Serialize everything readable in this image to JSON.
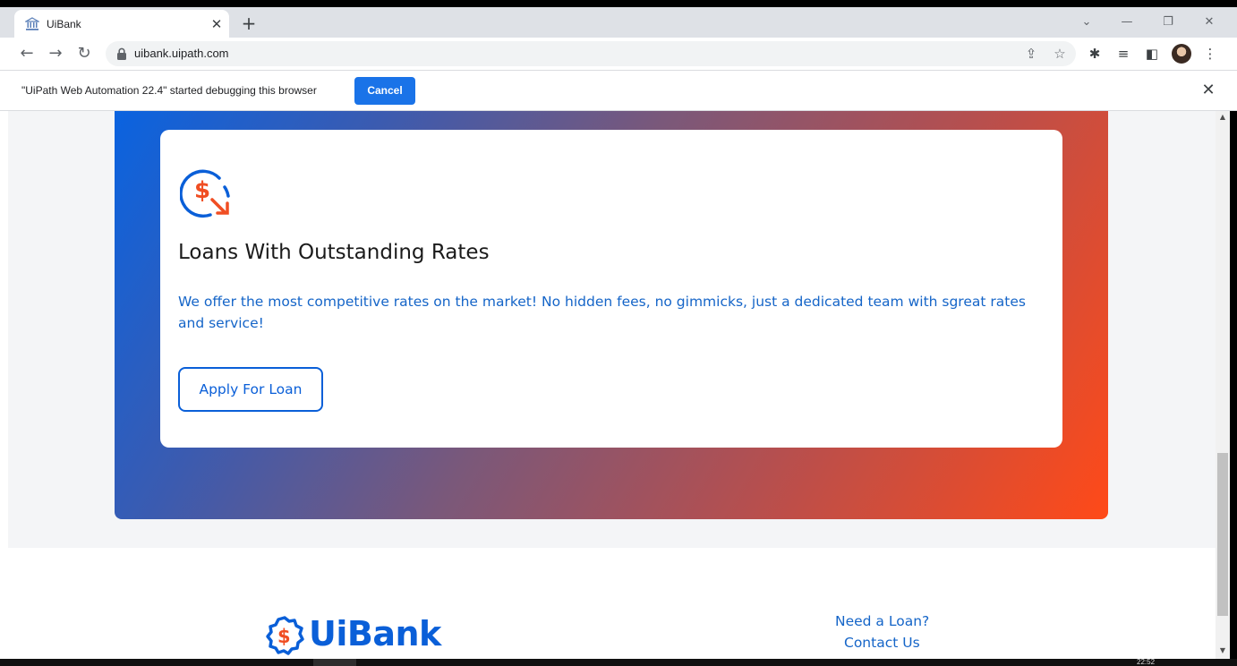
{
  "browser": {
    "tab": {
      "title": "UiBank",
      "favicon": "bank-icon"
    },
    "window_controls": [
      "chevron-down-icon",
      "minimize-icon",
      "restore-icon",
      "close-icon"
    ],
    "address_bar": {
      "url": "uibank.uipath.com"
    },
    "debug_bar": {
      "message": "\"UiPath Web Automation 22.4\" started debugging this browser",
      "cancel_label": "Cancel"
    }
  },
  "promo_card": {
    "icon": "dollar-rate-down-icon",
    "title": "Loans With Outstanding Rates",
    "description": "We offer the most competitive rates on the market! No hidden fees, no gimmicks, just a dedicated team with sgreat rates and service!",
    "button_label": "Apply For Loan"
  },
  "footer": {
    "logo_text": "UiBank",
    "links": [
      "Need a Loan?",
      "Contact Us"
    ]
  },
  "taskbar": {
    "clock": "22:52"
  },
  "colors": {
    "brand_blue": "#0a5fd8",
    "gradient_start": "#0a63e0",
    "gradient_end": "#ff4a18",
    "icon_orange": "#f04e23",
    "chrome_button_blue": "#1a73e8"
  }
}
